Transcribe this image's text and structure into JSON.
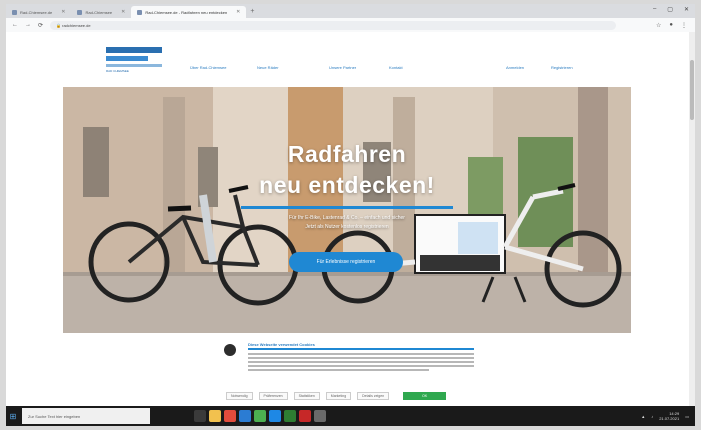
{
  "browser": {
    "tabs": [
      {
        "label": "Rad-Chiemsee.de",
        "active": false
      },
      {
        "label": "Rad-Chiemsee",
        "active": false
      },
      {
        "label": "Rad-Chiemsee.de - Radfahren neu entdecken",
        "active": true
      }
    ],
    "url": "radchiemsee.de"
  },
  "nav": {
    "logo_caption": "RAD CHIEMSEE",
    "links": [
      "Über Rad-Chiemsee",
      "Neue Räder",
      "Unsere Partner",
      "Kontakt"
    ],
    "right_links": [
      "Anmelden",
      "Registrieren"
    ]
  },
  "hero": {
    "title_line1": "Radfahren",
    "title_line2": "neu entdecken!",
    "subtitle_line1": "Für Ihr E-Bike, Lastenrad & Co. – einfach und sicher",
    "subtitle_line2": "Jetzt als Nutzer kostenlos registrieren",
    "cta_label": "Für Erlebnisse registrieren"
  },
  "cookie": {
    "title": "Diese Webseite verwendet Cookies",
    "buttons": [
      "Notwendig",
      "Präferenzen",
      "Statistiken",
      "Marketing",
      "Details zeigen"
    ],
    "accept_label": "OK"
  },
  "taskbar": {
    "search_placeholder": "Zur Suche Text hier eingeben",
    "time": "14:29",
    "date": "21.07.2021"
  },
  "colors": {
    "accent": "#1f88d3",
    "accept": "#2fa84f",
    "taskbar": "#1a1a1a"
  }
}
